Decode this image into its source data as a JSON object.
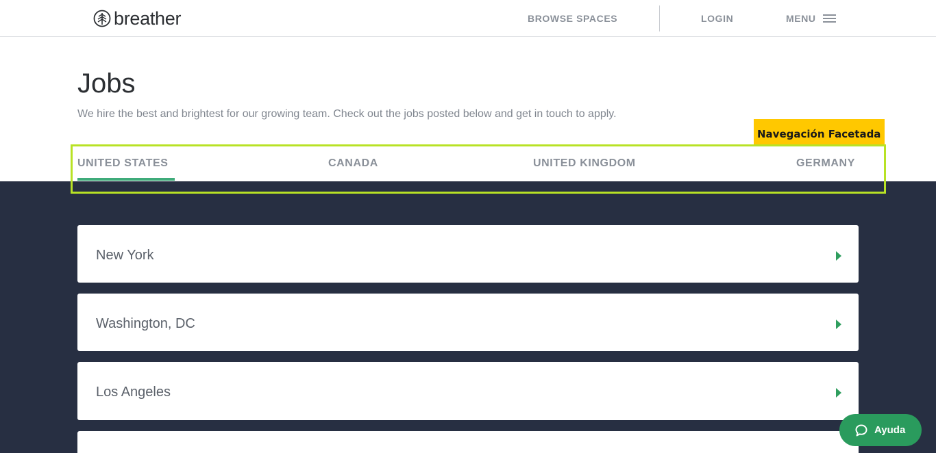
{
  "header": {
    "logo_text": "breather",
    "nav": {
      "browse_spaces": "BROWSE SPACES",
      "login": "LOGIN",
      "menu": "MENU"
    }
  },
  "main": {
    "title": "Jobs",
    "subtitle": "We hire the best and brightest for our growing team. Check out the jobs posted below and get in touch to apply."
  },
  "annotation": {
    "label": "Navegación Facetada",
    "highlight_color": "#b8e225",
    "label_color": "#ffc800"
  },
  "tabs": [
    {
      "label": "UNITED STATES",
      "active": true
    },
    {
      "label": "CANADA",
      "active": false
    },
    {
      "label": "UNITED KINGDOM",
      "active": false
    },
    {
      "label": "GERMANY",
      "active": false
    }
  ],
  "locations": [
    {
      "name": "New York"
    },
    {
      "name": "Washington, DC"
    },
    {
      "name": "Los Angeles"
    }
  ],
  "help_button": {
    "label": "Ayuda",
    "icon": "chat-bubble-icon"
  },
  "colors": {
    "accent": "#3fab7a",
    "dark_background": "#272f42",
    "arrow": "#2f9e5e",
    "help_button": "#2a9b5d"
  }
}
